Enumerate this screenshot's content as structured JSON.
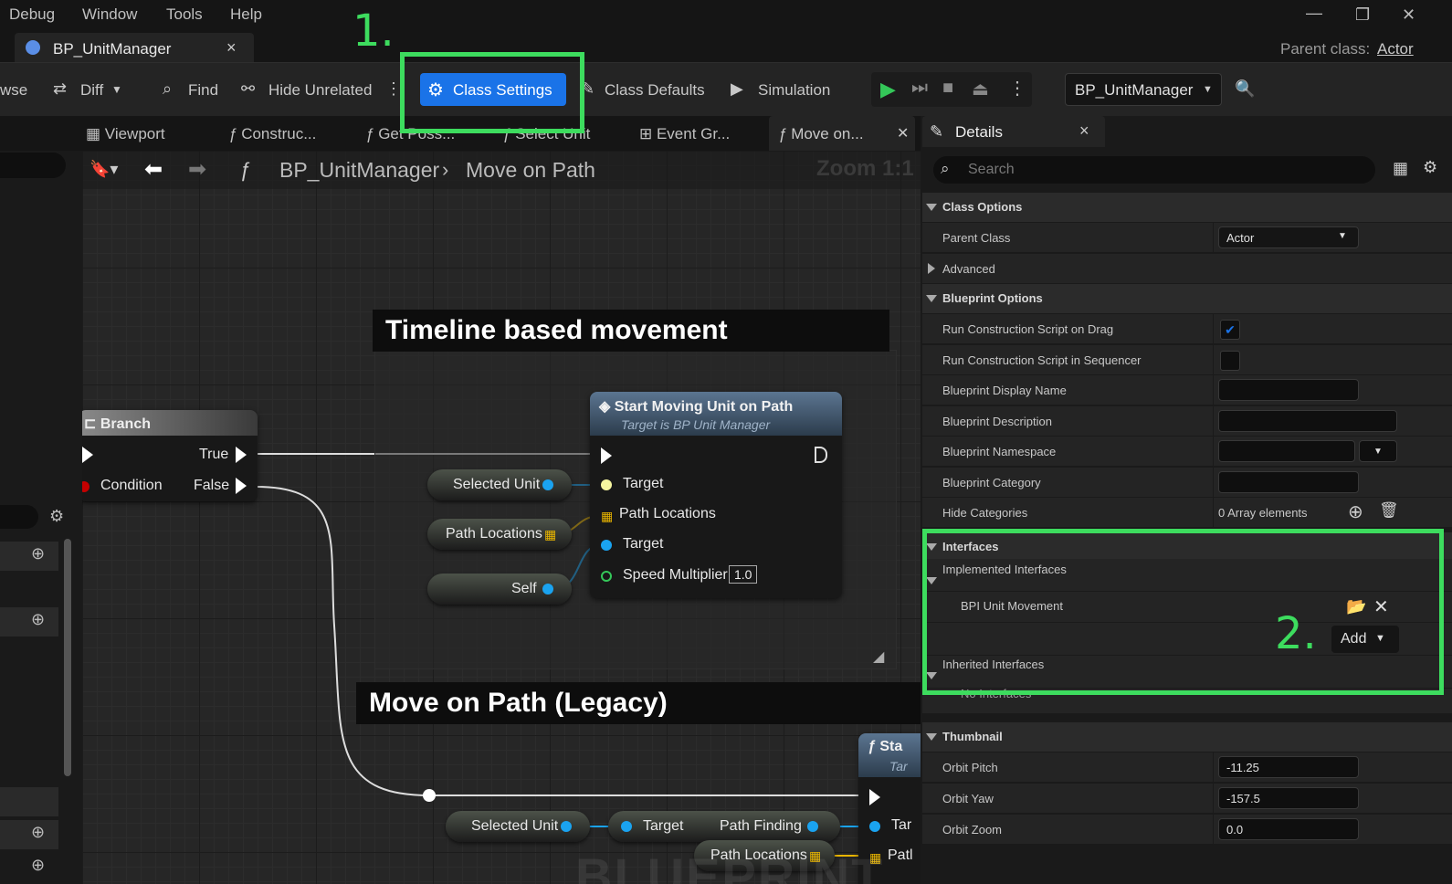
{
  "menu": {
    "items": [
      "Debug",
      "Window",
      "Tools",
      "Help"
    ]
  },
  "window_controls": {
    "minimize": "—",
    "restore": "❐",
    "close": "✕"
  },
  "tab": {
    "title": "BP_UnitManager",
    "close": "×"
  },
  "parent_class_header": {
    "label": "Parent class:",
    "value": "Actor"
  },
  "toolbar": {
    "browse": "wse",
    "diff": "Diff",
    "find": "Find",
    "hide_unrelated": "Hide Unrelated",
    "class_settings": "Class Settings",
    "class_defaults": "Class Defaults",
    "simulation": "Simulation",
    "blueprint_select": "BP_UnitManager"
  },
  "annotations": {
    "step1": "1.",
    "step2": "2."
  },
  "subtabs": [
    "Viewport",
    "Construc...",
    "Get Poss...",
    "Select Unit",
    "Event Gr...",
    "Move on..."
  ],
  "breadcrumb": {
    "root": "BP_UnitManager",
    "current": "Move on Path",
    "zoom": "Zoom 1:1"
  },
  "graph": {
    "comment1": "Timeline based movement",
    "comment2": "Move on Path (Legacy)",
    "branch": {
      "title": "Branch",
      "true": "True",
      "false": "False",
      "condition": "Condition"
    },
    "start_node": {
      "title": "Start Moving Unit on Path",
      "subtitle": "Target is BP Unit Manager",
      "pins": [
        "Target",
        "Path Locations",
        "Target",
        "Speed Multiplier"
      ],
      "speed_value": "1.0"
    },
    "vars": {
      "selected_unit": "Selected Unit",
      "path_locations": "Path Locations",
      "self": "Self"
    },
    "legacy": {
      "selected_unit": "Selected Unit",
      "target": "Target",
      "path_finding": "Path Finding",
      "path_locations": "Path Locations",
      "node_title": "Sta",
      "node_sub": "Tar",
      "pin_target": "Tar",
      "pin_path": "Patl"
    },
    "watermark": "BLUEPRINT"
  },
  "details": {
    "title": "Details",
    "close": "×",
    "search_placeholder": "Search",
    "class_options": {
      "header": "Class Options",
      "parent_class_label": "Parent Class",
      "parent_class_value": "Actor",
      "advanced": "Advanced"
    },
    "blueprint_options": {
      "header": "Blueprint Options",
      "run_cs_on_drag": "Run Construction Script on Drag",
      "run_cs_on_drag_checked": true,
      "run_cs_in_sequencer": "Run Construction Script in Sequencer",
      "run_cs_in_sequencer_checked": false,
      "display_name": "Blueprint Display Name",
      "description": "Blueprint Description",
      "namespace": "Blueprint Namespace",
      "category": "Blueprint Category",
      "hide_categories": "Hide Categories",
      "hide_categories_value": "0 Array elements"
    },
    "interfaces": {
      "header": "Interfaces",
      "implemented": "Implemented Interfaces",
      "item": "BPI Unit Movement",
      "add": "Add",
      "inherited": "Inherited Interfaces",
      "no_interfaces": "No Interfaces"
    },
    "thumbnail": {
      "header": "Thumbnail",
      "orbit_pitch": "Orbit Pitch",
      "orbit_pitch_value": "-11.25",
      "orbit_yaw": "Orbit Yaw",
      "orbit_yaw_value": "-157.5",
      "orbit_zoom": "Orbit Zoom",
      "orbit_zoom_value": "0.0"
    }
  },
  "colors": {
    "accent": "#1a73e8",
    "highlight": "#3ddc5e",
    "play": "#34c759"
  }
}
